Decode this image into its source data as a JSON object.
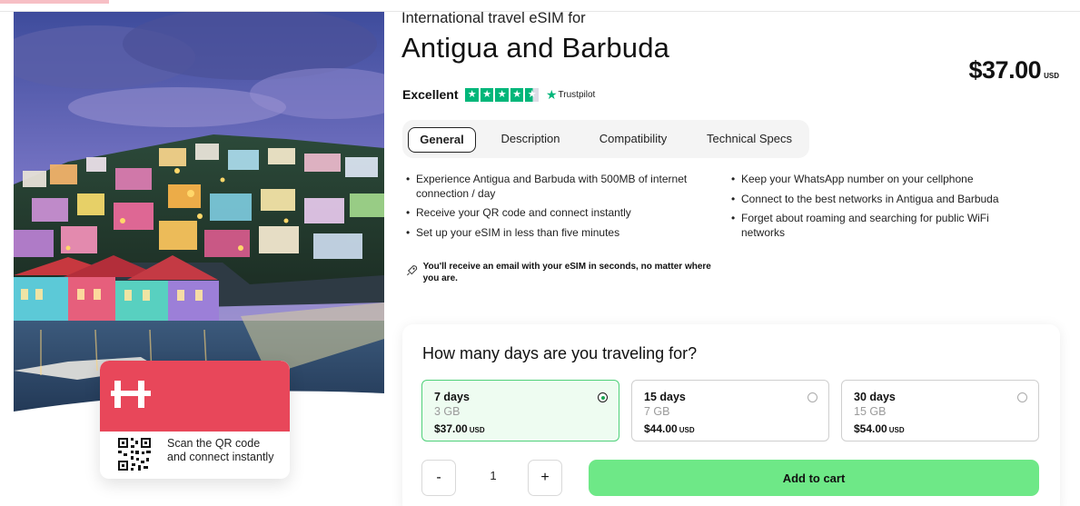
{
  "header": {
    "subtitle": "International travel eSIM for",
    "title": "Antigua and Barbuda",
    "price": "$37.00",
    "currency": "USD"
  },
  "rating": {
    "label": "Excellent",
    "stars": 4.5,
    "provider": "Trustpilot",
    "star_color": "#00b67a"
  },
  "tabs": [
    {
      "label": "General",
      "active": true
    },
    {
      "label": "Description",
      "active": false
    },
    {
      "label": "Compatibility",
      "active": false
    },
    {
      "label": "Technical Specs",
      "active": false
    }
  ],
  "features": {
    "left": [
      "Experience Antigua and Barbuda with 500MB of internet connection / day",
      "Receive your QR code and connect instantly",
      "Set up your eSIM in less than five minutes"
    ],
    "right": [
      "Keep your WhatsApp number on your cellphone",
      "Connect to the best networks in Antigua and Barbuda",
      "Forget about roaming and searching for public WiFi networks"
    ]
  },
  "note": {
    "icon": "rocket-icon",
    "text": "You'll receive an email with your eSIM in seconds, no matter where you are."
  },
  "card": {
    "logo": "H",
    "text": "Scan the QR code and connect instantly",
    "color": "#e8475a"
  },
  "plans": {
    "question": "How many days are you traveling for?",
    "options": [
      {
        "days": "7 days",
        "data": "3 GB",
        "price": "$37.00",
        "currency": "USD",
        "selected": true
      },
      {
        "days": "15 days",
        "data": "7 GB",
        "price": "$44.00",
        "currency": "USD",
        "selected": false
      },
      {
        "days": "30 days",
        "data": "15 GB",
        "price": "$54.00",
        "currency": "USD",
        "selected": false
      }
    ]
  },
  "purchase": {
    "minus": "-",
    "quantity": "1",
    "plus": "+",
    "add_to_cart": "Add to cart",
    "button_color": "#6ee887"
  }
}
